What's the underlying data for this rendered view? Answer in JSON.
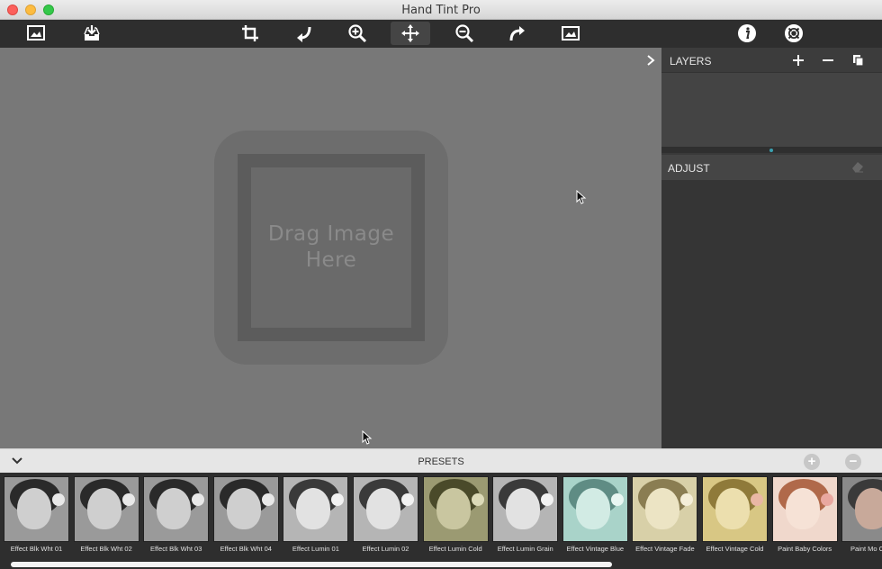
{
  "window": {
    "title": "Hand Tint Pro"
  },
  "canvas": {
    "placeholder": "Drag Image Here"
  },
  "panels": {
    "layers": {
      "label": "LAYERS"
    },
    "adjust": {
      "label": "ADJUST"
    }
  },
  "presets": {
    "label": "PRESETS",
    "items": [
      {
        "name": "Effect Blk Wht 01",
        "tone": "bw"
      },
      {
        "name": "Effect Blk Wht 02",
        "tone": "bw"
      },
      {
        "name": "Effect Blk Wht 03",
        "tone": "bw"
      },
      {
        "name": "Effect Blk Wht 04",
        "tone": "bw"
      },
      {
        "name": "Effect Lumin 01",
        "tone": "bw-light"
      },
      {
        "name": "Effect Lumin 02",
        "tone": "bw-light"
      },
      {
        "name": "Effect Lumin Cold",
        "tone": "olive"
      },
      {
        "name": "Effect Lumin Grain",
        "tone": "bw-light"
      },
      {
        "name": "Effect Vintage Blue",
        "tone": "teal"
      },
      {
        "name": "Effect Vintage Fade",
        "tone": "cream"
      },
      {
        "name": "Effect Vintage Cold",
        "tone": "yellow"
      },
      {
        "name": "Paint Baby Colors",
        "tone": "peach"
      },
      {
        "name": "Paint Mo Colors",
        "tone": "color"
      }
    ]
  },
  "colors": {
    "canvas_bg": "#787878",
    "panel_bg": "#3a3a3a",
    "accent_dot": "#3aa0b0"
  }
}
